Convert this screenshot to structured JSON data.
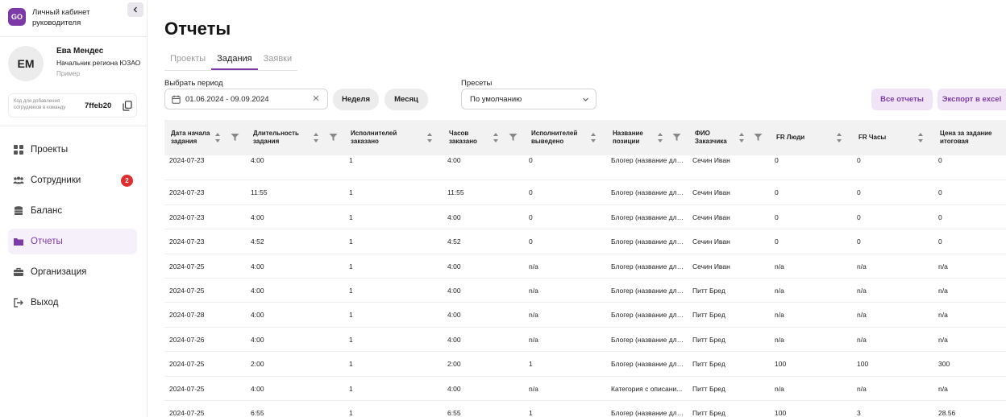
{
  "sidebar": {
    "logo_text": "GO",
    "brand_line1": "Личный кабинет",
    "brand_line2": "руководителя",
    "profile": {
      "initials": "ЕМ",
      "name": "Ева Мендес",
      "role": "Начальник региона ЮЗАО",
      "tag": "Пример"
    },
    "invite": {
      "label": "Код для добавления сотрудников в команду",
      "code": "7ffeb20"
    },
    "nav": [
      {
        "label": "Проекты",
        "icon": "grid-icon"
      },
      {
        "label": "Сотрудники",
        "icon": "people-icon",
        "badge": "2"
      },
      {
        "label": "Баланс",
        "icon": "coins-icon"
      },
      {
        "label": "Отчеты",
        "icon": "folder-icon",
        "active": true
      },
      {
        "label": "Организация",
        "icon": "briefcase-icon"
      },
      {
        "label": "Выход",
        "icon": "logout-icon"
      }
    ]
  },
  "main": {
    "title": "Отчеты",
    "tabs": [
      {
        "label": "Проекты"
      },
      {
        "label": "Задания",
        "active": true
      },
      {
        "label": "Заявки"
      }
    ],
    "period_label": "Выбрать период",
    "period_value": "01.06.2024 - 09.09.2024",
    "week_button": "Неделя",
    "month_button": "Месяц",
    "presets_label": "Пресеты",
    "presets_value": "По умолчанию",
    "all_reports_button": "Все отчеты",
    "export_button": "Экспорт в excel"
  },
  "colors": {
    "accent": "#7b3aa8",
    "accent_light": "#f1e4f7",
    "badge": "#e02d2d"
  },
  "table": {
    "columns": [
      "Дата начала задания",
      "Длительность задания",
      "Исполнителей заказано",
      "Часов заказано",
      "Исполнителей выведено",
      "Название позиции",
      "ФИО Заказчика",
      "FR Люди",
      "FR Часы",
      "Цена за задание итоговая"
    ],
    "rows": [
      [
        "2024-07-23",
        "4:00",
        "1",
        "4:00",
        "0",
        "Блогер (название для...",
        "Сечин Иван",
        "0",
        "0",
        "0"
      ],
      [
        "2024-07-23",
        "11:55",
        "1",
        "11:55",
        "0",
        "Блогер (название для...",
        "Сечин Иван",
        "0",
        "0",
        "0"
      ],
      [
        "2024-07-23",
        "4:00",
        "1",
        "4:00",
        "0",
        "Блогер (название для...",
        "Сечин Иван",
        "0",
        "0",
        "0"
      ],
      [
        "2024-07-23",
        "4:52",
        "1",
        "4:52",
        "0",
        "Блогер (название для...",
        "Сечин Иван",
        "0",
        "0",
        "0"
      ],
      [
        "2024-07-25",
        "4:00",
        "1",
        "4:00",
        "n/a",
        "Блогер (название для...",
        "Сечин Иван",
        "n/a",
        "n/a",
        "n/a"
      ],
      [
        "2024-07-25",
        "4:00",
        "1",
        "4:00",
        "n/a",
        "Блогер (название для...",
        "Питт Бред",
        "n/a",
        "n/a",
        "n/a"
      ],
      [
        "2024-07-28",
        "4:00",
        "1",
        "4:00",
        "n/a",
        "Блогер (название для...",
        "Питт Бред",
        "n/a",
        "n/a",
        "n/a"
      ],
      [
        "2024-07-26",
        "4:00",
        "1",
        "4:00",
        "n/a",
        "Блогер (название для...",
        "Питт Бред",
        "n/a",
        "n/a",
        "n/a"
      ],
      [
        "2024-07-25",
        "2:00",
        "1",
        "2:00",
        "1",
        "Блогер (название для...",
        "Питт Бред",
        "100",
        "100",
        "300"
      ],
      [
        "2024-07-25",
        "4:00",
        "1",
        "4:00",
        "n/a",
        "Категория с описани...",
        "Питт Бред",
        "n/a",
        "n/a",
        "n/a"
      ],
      [
        "2024-07-25",
        "6:55",
        "1",
        "6:55",
        "1",
        "Блогер (название для...",
        "Питт Бред",
        "100",
        "3",
        "28.56"
      ]
    ]
  }
}
